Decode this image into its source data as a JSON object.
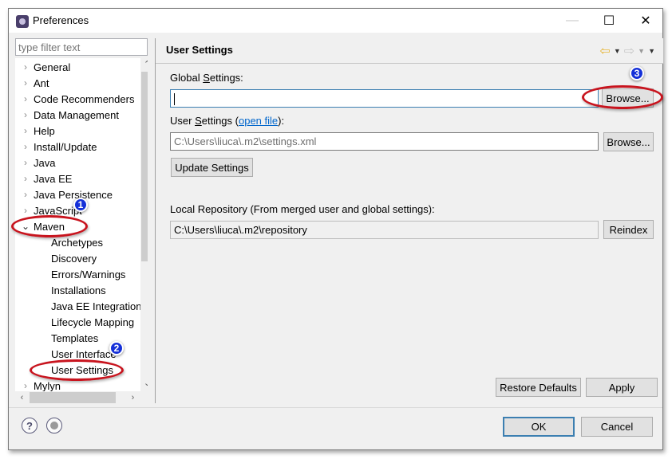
{
  "window": {
    "title": "Preferences",
    "icon": "eclipse-preferences-icon",
    "controls": {
      "minimize": "—",
      "maximize": "☐",
      "close": "✕"
    }
  },
  "sidebar": {
    "filter_placeholder": "type filter text",
    "items": [
      {
        "label": "General",
        "expander": "›",
        "level": 0
      },
      {
        "label": "Ant",
        "expander": "›",
        "level": 0
      },
      {
        "label": "Code Recommenders",
        "expander": "›",
        "level": 0
      },
      {
        "label": "Data Management",
        "expander": "›",
        "level": 0
      },
      {
        "label": "Help",
        "expander": "›",
        "level": 0
      },
      {
        "label": "Install/Update",
        "expander": "›",
        "level": 0
      },
      {
        "label": "Java",
        "expander": "›",
        "level": 0
      },
      {
        "label": "Java EE",
        "expander": "›",
        "level": 0
      },
      {
        "label": "Java Persistence",
        "expander": "›",
        "level": 0
      },
      {
        "label": "JavaScript",
        "expander": "›",
        "level": 0
      },
      {
        "label": "Maven",
        "expander": "⌄",
        "level": 0,
        "expanded": true
      },
      {
        "label": "Archetypes",
        "level": 1
      },
      {
        "label": "Discovery",
        "level": 1
      },
      {
        "label": "Errors/Warnings",
        "level": 1
      },
      {
        "label": "Installations",
        "level": 1
      },
      {
        "label": "Java EE Integration",
        "level": 1
      },
      {
        "label": "Lifecycle Mapping",
        "level": 1
      },
      {
        "label": "Templates",
        "level": 1
      },
      {
        "label": "User Interface",
        "level": 1
      },
      {
        "label": "User Settings",
        "level": 1,
        "selected": true
      },
      {
        "label": "Mylyn",
        "expander": "›",
        "level": 0
      }
    ],
    "scroll_up": "⌃",
    "scroll_down": "⌄",
    "scroll_left": "‹",
    "scroll_right": "›"
  },
  "page": {
    "title": "User Settings",
    "nav": {
      "back": "⇦",
      "forward": "⇨",
      "dropdown": "▼",
      "menu": "▼"
    },
    "global_settings": {
      "label_pre": "Global ",
      "label_mnemonic": "S",
      "label_post": "ettings:",
      "value": "",
      "browse_label": "Browse..."
    },
    "user_settings": {
      "label_pre": "User ",
      "label_mnemonic": "S",
      "label_post": "ettings (",
      "link": "open file",
      "label_end": "):",
      "value": "C:\\Users\\liuca\\.m2\\settings.xml",
      "browse_label": "Browse...",
      "update_label": "Update Settings"
    },
    "local_repository": {
      "label": "Local Repository (From merged user and global settings):",
      "value": "C:\\Users\\liuca\\.m2\\repository",
      "reindex_label": "Reindex"
    },
    "restore_defaults_label": "Restore Defaults",
    "apply_label": "Apply"
  },
  "footer": {
    "help_icon": "?",
    "ok_label": "OK",
    "cancel_label": "Cancel"
  },
  "annotations": [
    {
      "number": "1",
      "target": "Maven"
    },
    {
      "number": "2",
      "target": "User Settings"
    },
    {
      "number": "3",
      "target": "Browse..."
    }
  ],
  "colors": {
    "annotation_ring": "#c8141e",
    "annotation_badge": "#1530d8",
    "focus_border": "#3c7fb1",
    "link": "#0066cc"
  }
}
